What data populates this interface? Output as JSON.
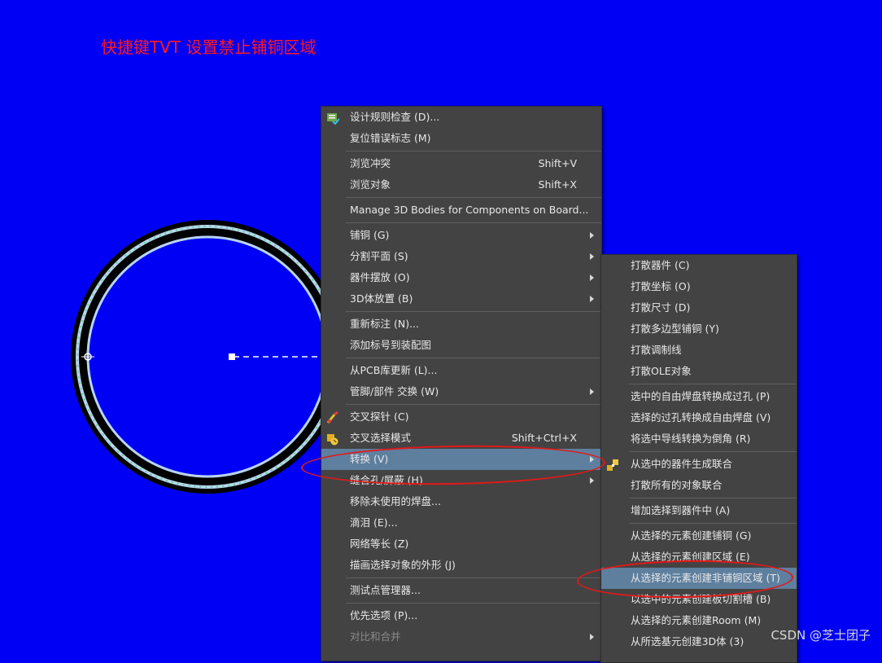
{
  "annotation": "快捷键TVT 设置禁止铺铜区域",
  "main_menu": [
    {
      "label": "设计规则检查 (D)...",
      "icon": "drc-check-icon"
    },
    {
      "label": "复位错误标志 (M)"
    },
    {
      "sep": true
    },
    {
      "label": "浏览冲突",
      "shortcut": "Shift+V"
    },
    {
      "label": "浏览对象",
      "shortcut": "Shift+X"
    },
    {
      "sep": true
    },
    {
      "label": "Manage 3D Bodies for Components on Board..."
    },
    {
      "sep": true
    },
    {
      "label": "铺铜 (G)",
      "submenu": true
    },
    {
      "label": "分割平面 (S)",
      "submenu": true
    },
    {
      "label": "器件摆放 (O)",
      "submenu": true
    },
    {
      "label": "3D体放置 (B)",
      "submenu": true
    },
    {
      "sep": true
    },
    {
      "label": "重新标注 (N)..."
    },
    {
      "label": "添加标号到装配图"
    },
    {
      "sep": true
    },
    {
      "label": "从PCB库更新 (L)..."
    },
    {
      "label": "管脚/部件 交换 (W)",
      "submenu": true
    },
    {
      "sep": true
    },
    {
      "label": "交叉探针 (C)",
      "icon": "cross-probe-icon"
    },
    {
      "label": "交叉选择模式",
      "shortcut": "Shift+Ctrl+X",
      "icon": "cross-select-icon"
    },
    {
      "label": "转换 (V)",
      "submenu": true,
      "highlight": true
    },
    {
      "label": "缝合孔/屏蔽 (H)",
      "submenu": true
    },
    {
      "label": "移除未使用的焊盘..."
    },
    {
      "label": "滴泪 (E)..."
    },
    {
      "label": "网络等长 (Z)"
    },
    {
      "label": "描画选择对象的外形 (J)"
    },
    {
      "sep": true
    },
    {
      "label": "测试点管理器..."
    },
    {
      "sep": true
    },
    {
      "label": "优先选项 (P)..."
    },
    {
      "label": "对比和合并",
      "submenu": true,
      "disabled": true
    }
  ],
  "sub_menu": [
    {
      "label": "打散器件 (C)"
    },
    {
      "label": "打散坐标 (O)"
    },
    {
      "label": "打散尺寸 (D)"
    },
    {
      "label": "打散多边型铺铜 (Y)"
    },
    {
      "label": "打散调制线"
    },
    {
      "label": "打散OLE对象"
    },
    {
      "sep": true
    },
    {
      "label": "选中的自由焊盘转换成过孔 (P)"
    },
    {
      "label": "选择的过孔转换成自由焊盘 (V)"
    },
    {
      "label": "将选中导线转换为倒角 (R)"
    },
    {
      "sep": true
    },
    {
      "label": "从选中的器件生成联合",
      "icon": "union-icon"
    },
    {
      "label": "打散所有的对象联合"
    },
    {
      "sep": true
    },
    {
      "label": "增加选择到器件中 (A)"
    },
    {
      "sep": true
    },
    {
      "label": "从选择的元素创建铺铜 (G)"
    },
    {
      "label": "从选择的元素创建区域 (E)"
    },
    {
      "label": "从选择的元素创建非铺铜区域 (T)",
      "highlight": true
    },
    {
      "label": "以选中的元素创建板切割槽 (B)"
    },
    {
      "label": "从选择的元素创建Room (M)"
    },
    {
      "label": "从所选基元创建3D体 (3)"
    }
  ],
  "watermark": "CSDN @芝士团子",
  "colors": {
    "background": "#0000f5",
    "annotation": "#ff1a1a",
    "menu_bg": "#434343",
    "highlight": "#5e7f9e",
    "ring_outer": "#000000",
    "ring_inner": "#b8d4f0",
    "red_mark": "#e41818"
  }
}
